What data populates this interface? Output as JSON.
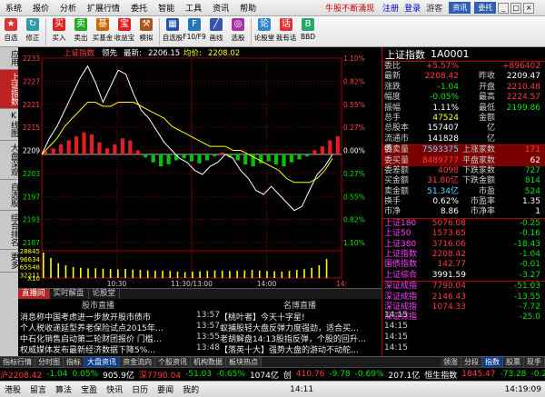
{
  "menu": {
    "items": [
      "系统",
      "报价",
      "分析",
      "扩展行情",
      "委托",
      "智能",
      "工具",
      "资讯",
      "帮助"
    ],
    "promo": "牛股不断涌现",
    "login": "注册",
    "register": "登录",
    "guest": "游客",
    "btn_news": "资讯",
    "btn_trade": "委托"
  },
  "toolbar": [
    {
      "label": "自选",
      "color": "#d33",
      "glyph": "★"
    },
    {
      "label": "修正",
      "color": "#39a",
      "glyph": "↻"
    },
    {
      "label": "买入",
      "color": "#d22",
      "glyph": "买"
    },
    {
      "label": "卖出",
      "color": "#2a2",
      "glyph": "卖"
    },
    {
      "label": "买基金",
      "color": "#c60",
      "glyph": "基"
    },
    {
      "label": "收益宝",
      "color": "#d22",
      "glyph": "宝"
    },
    {
      "label": "模拟",
      "color": "#a52",
      "glyph": "⚒"
    },
    {
      "label": "自选股",
      "color": "#25a",
      "glyph": "▦"
    },
    {
      "label": "F10/F9",
      "color": "#27b",
      "glyph": "F"
    },
    {
      "label": "画线",
      "color": "#35a",
      "glyph": "╱"
    },
    {
      "label": "选股",
      "color": "#a3a",
      "glyph": "◎"
    },
    {
      "label": "论股堂",
      "color": "#38c",
      "glyph": "论"
    },
    {
      "label": "我有话",
      "color": "#d33",
      "glyph": "话"
    },
    {
      "label": "BBD",
      "color": "#2a6",
      "glyph": "B"
    }
  ],
  "left_tabs": [
    {
      "label": "应用",
      "active": false
    },
    {
      "label": "上证指数",
      "active": true
    },
    {
      "label": "K线图",
      "active": false
    },
    {
      "label": "大盘深观",
      "active": false
    },
    {
      "label": "自选股",
      "active": false
    },
    {
      "label": "综合排名",
      "active": false
    },
    {
      "label": "更多",
      "active": false
    }
  ],
  "chart": {
    "header_name": "上证指数",
    "header_lead": "领先",
    "header_latest": "2206.15",
    "header_avg": "2208.02",
    "header_latest_label": "最新:",
    "header_avg_label": "均价:",
    "price_ticks": [
      "2233",
      "2227",
      "2221",
      "2215",
      "2209",
      "2203",
      "2197",
      "2193",
      "2187"
    ],
    "pct_ticks": [
      "1.10%",
      "0.82%",
      "0.55%",
      "0.27%",
      "0.00%",
      "0.27%",
      "0.55%",
      "0.82%",
      "1.10%"
    ],
    "vol_ticks": [
      "128845",
      "96634",
      "65548",
      "32211"
    ],
    "vol_unit": "X10",
    "time_ticks": [
      "10:30",
      "11:30/13:00",
      "14:00"
    ],
    "zoom_label": "14:"
  },
  "chart_data": {
    "type": "line",
    "prev_close": 2209,
    "ylim": [
      2187,
      2233
    ],
    "x_start": "09:30",
    "x_end": "15:00",
    "series": [
      {
        "name": "最新",
        "color": "#ffffff",
        "values": [
          2209,
          2213,
          2216,
          2220,
          2224,
          2228,
          2231,
          2227,
          2222,
          2226,
          2230,
          2229,
          2224,
          2220,
          2218,
          2215,
          2212,
          2210,
          2208,
          2207,
          2205,
          2204,
          2206,
          2207,
          2209,
          2208,
          2205,
          2203,
          2200,
          2199,
          2201,
          2199,
          2197,
          2195,
          2196,
          2200,
          2204,
          2206,
          2209
        ]
      },
      {
        "name": "均价",
        "color": "#ffff00",
        "values": [
          2209,
          2211,
          2213,
          2216,
          2218,
          2220,
          2222,
          2222,
          2221,
          2221,
          2222,
          2222,
          2222,
          2221,
          2220,
          2219,
          2218,
          2216,
          2215,
          2214,
          2213,
          2212,
          2211,
          2211,
          2211,
          2210,
          2210,
          2209,
          2208,
          2207,
          2206,
          2205,
          2203,
          2202,
          2202,
          2202,
          2203,
          2205,
          2208
        ]
      }
    ],
    "net_bars": [
      3,
      6,
      10,
      14,
      18,
      22,
      20,
      12,
      6,
      10,
      16,
      14,
      4,
      -3,
      -8,
      -12,
      -10,
      -6,
      -4,
      -7,
      -9,
      -6,
      -2,
      2,
      -3,
      -6,
      -10,
      -12,
      -9,
      -7,
      -10,
      -12,
      -8,
      -5,
      -2,
      4,
      8,
      14,
      18
    ],
    "volume": [
      120000,
      95000,
      70000,
      60000,
      52000,
      48000,
      45000,
      46000,
      44000,
      42000,
      41000,
      43000,
      40000,
      38000,
      36000,
      35000,
      34000,
      33000,
      30000,
      28000,
      30000,
      32000,
      34000,
      36000,
      35000,
      33000,
      34000,
      36000,
      38000,
      35000,
      33000,
      32000,
      30000,
      34000,
      38000,
      42000,
      48000,
      60000,
      90000
    ]
  },
  "quote": {
    "title": "上证指数",
    "code": "1A0001",
    "rows": [
      {
        "l1": "委比",
        "v1": "+5.57%",
        "c1": "red",
        "l2": "",
        "v2": "+896402",
        "c2": "red"
      },
      {
        "l1": "最新",
        "v1": "2208.42",
        "c1": "red",
        "l2": "昨收",
        "v2": "2209.47",
        "c2": "wht"
      },
      {
        "l1": "涨跌",
        "v1": "-1.04",
        "c1": "grn",
        "l2": "开盘",
        "v2": "2210.48",
        "c2": "red"
      },
      {
        "l1": "幅度",
        "v1": "-0.05%",
        "c1": "grn",
        "l2": "最高",
        "v2": "2224.57",
        "c2": "red"
      },
      {
        "l1": "振幅",
        "v1": "1.11%",
        "c1": "wht",
        "l2": "最低",
        "v2": "2199.86",
        "c2": "grn"
      },
      {
        "l1": "总手",
        "v1": "47524",
        "c1": "yel",
        "l2": "金额",
        "v2": "",
        "c2": "wht"
      },
      {
        "l1": "总股本",
        "v1": "157407",
        "c1": "wht",
        "l2": "亿",
        "v2": "",
        "c2": "wht"
      },
      {
        "l1": "流通市值",
        "v1": "141828",
        "c1": "wht",
        "l2": "亿",
        "v2": "",
        "c2": "wht"
      },
      {
        "l1": "委卖量",
        "v1": "7593375",
        "c1": "cyn",
        "l2": "上涨家数",
        "v2": "171",
        "c2": "red"
      },
      {
        "l1": "委买量",
        "v1": "8489777",
        "c1": "red",
        "l2": "平盘家数",
        "v2": "62",
        "c2": "wht"
      },
      {
        "l1": "委差额",
        "v1": "4098",
        "c1": "red",
        "l2": "下跌家数",
        "v2": "727",
        "c2": "grn"
      },
      {
        "l1": "买金额",
        "v1": "31.80亿",
        "c1": "red",
        "l2": "下跌金额",
        "v2": "814",
        "c2": "grn"
      },
      {
        "l1": "卖金额",
        "v1": "51.34亿",
        "c1": "cyn",
        "l2": "市盈",
        "v2": "524",
        "c2": "grn"
      },
      {
        "l1": "换手",
        "v1": "0.62%",
        "c1": "wht",
        "l2": "市盈率",
        "v2": "1.35",
        "c2": "wht"
      },
      {
        "l1": "市净",
        "v1": "8.86",
        "c1": "wht",
        "l2": "市净率",
        "v2": "1",
        "c2": "wht"
      },
      {
        "l1": "上证180",
        "v1": "5076.08",
        "c1": "red",
        "l2": "",
        "v2": "-0.25",
        "c2": "grn"
      },
      {
        "l1": "上证50",
        "v1": "1573.65",
        "c1": "red",
        "l2": "",
        "v2": "-0.16",
        "c2": "grn"
      },
      {
        "l1": "上证380",
        "v1": "3716.06",
        "c1": "red",
        "l2": "",
        "v2": "-18.43",
        "c2": "grn"
      },
      {
        "l1": "上证指数",
        "v1": "2208.42",
        "c1": "red",
        "l2": "",
        "v2": "-1.04",
        "c2": "grn"
      },
      {
        "l1": "国债指数",
        "v1": "142.77",
        "c1": "red",
        "l2": "",
        "v2": "-0.01",
        "c2": "grn"
      },
      {
        "l1": "上证综合",
        "v1": "3991.59",
        "c1": "wht",
        "l2": "",
        "v2": "-3.27",
        "c2": "grn"
      },
      {
        "l1": "深证成指",
        "v1": "7790.04",
        "c1": "red",
        "l2": "",
        "v2": "-51.03",
        "c2": "grn"
      },
      {
        "l1": "深证成指",
        "v1": "2146.43",
        "c1": "red",
        "l2": "",
        "v2": "-13.55",
        "c2": "grn"
      },
      {
        "l1": "深证成指",
        "v1": "1074.33",
        "c1": "red",
        "l2": "",
        "v2": "-7.72",
        "c2": "grn"
      },
      {
        "l1": "深证综指",
        "v1": "",
        "c1": "wht",
        "l2": "",
        "v2": "-25.0",
        "c2": "grn"
      }
    ]
  },
  "news_tabs": [
    "直播间",
    "实时解盘",
    "论股堂"
  ],
  "news": {
    "left_header": "股市直播",
    "right_header": "名博直播",
    "left": [
      {
        "text": "消息称中国考虑进一步放开股市债市",
        "time": "13:57"
      },
      {
        "text": "个人税收递延型养老保险试点2015年…",
        "time": "13:57"
      },
      {
        "text": "中石化销售启动第二轮财团报价 门槛…",
        "time": "13:55"
      },
      {
        "text": "权威媒体发布最新经济数据下降5%…",
        "time": "13:48"
      }
    ],
    "right": [
      {
        "text": "【桃叶者】今天十字星!",
        "time": "14:15"
      },
      {
        "text": "蚁捕股轻大盘反弹力度强劲，适合买…",
        "time": "14:15"
      },
      {
        "text": "老胡解盘14:13股指反弹，个股的回升…",
        "time": "14:15"
      },
      {
        "text": "【落英十大】强势大盘的游动不动舵…",
        "time": "14:15"
      }
    ]
  },
  "bottom_tabs": [
    "指标行情",
    "分时图",
    "指标",
    "大盘资讯",
    "资金流向",
    "个股资讯",
    "机构数据",
    "板块热点"
  ],
  "bottom_tabs_right": [
    "领涨",
    "分段",
    "指数",
    "股票",
    "现手"
  ],
  "ticker": [
    {
      "text": "沪2208.42",
      "c": "red"
    },
    {
      "text": "-1.04",
      "c": "grn"
    },
    {
      "text": "0.05%",
      "c": "grn"
    },
    {
      "text": "905.9亿",
      "c": "wht"
    },
    {
      "text": "深7790.04",
      "c": "red"
    },
    {
      "text": "-51.03",
      "c": "grn"
    },
    {
      "text": "-0.65%",
      "c": "grn"
    },
    {
      "text": "1074亿",
      "c": "wht"
    },
    {
      "text": "创",
      "c": "wht"
    },
    {
      "text": "410.76",
      "c": "red"
    },
    {
      "text": "-9.78",
      "c": "grn"
    },
    {
      "text": "-0.69%",
      "c": "grn"
    },
    {
      "text": "207.1亿",
      "c": "wht"
    },
    {
      "text": "恒生指数",
      "c": "wht"
    },
    {
      "text": "1845.47",
      "c": "red"
    },
    {
      "text": "-73.28",
      "c": "grn"
    },
    {
      "text": "-0.29%",
      "c": "grn"
    }
  ],
  "status": {
    "items": [
      "港股",
      "留言",
      "算法",
      "宝盈",
      "快讯",
      "日历",
      "要闻",
      "我的"
    ],
    "clock": "14:11",
    "time": "14:19:09"
  }
}
